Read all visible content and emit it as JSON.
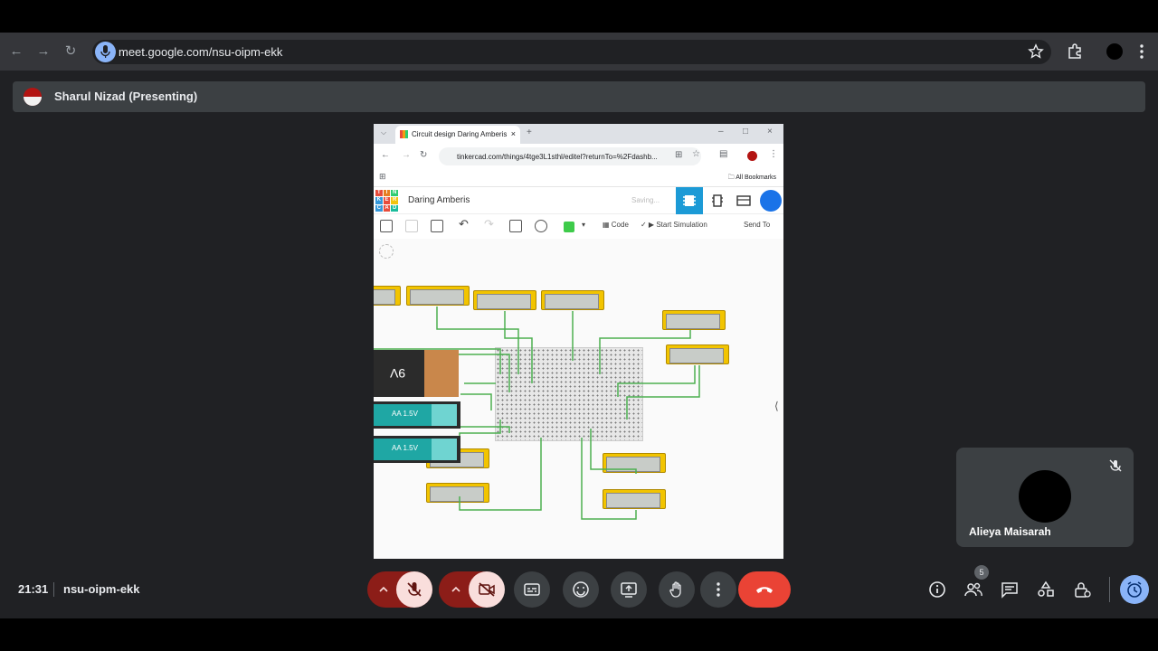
{
  "browser": {
    "url": "meet.google.com/nsu-oipm-ekk"
  },
  "presenter": {
    "name": "Sharul Nizad (Presenting)"
  },
  "shared_screen": {
    "tab_title": "Circuit design Daring Amberis",
    "url": "tinkercad.com/things/4tge3L1sthl/editel?returnTo=%2Fdashb...",
    "bookmarks_label": "All Bookmarks",
    "logo_letters": [
      "T",
      "I",
      "N",
      "K",
      "E",
      "R",
      "C",
      "A",
      "D"
    ],
    "logo_colors": [
      "#e74c3c",
      "#e67e22",
      "#2ecc71",
      "#3498db",
      "#e74c3c",
      "#f1c40f",
      "#3498db",
      "#e74c3c",
      "#1abc9c"
    ],
    "design_title": "Daring Amberis",
    "saving_text": "Saving...",
    "code_label": "Code",
    "start_simulation_label": "Start Simulation",
    "send_to_label": "Send To",
    "battery_9v_label": "9V",
    "aa_label_1": "AA 1.5V",
    "aa_label_2": "AA 1.5V"
  },
  "participant": {
    "name": "Alieya Maisarah"
  },
  "bottom": {
    "time": "21:31",
    "meeting_code": "nsu-oipm-ekk",
    "participants_count": "5"
  },
  "colors": {
    "end_call": "#ea4335",
    "mic_off_bg": "#f9dedc",
    "wire": "#4caf50",
    "accent": "#8ab4f8"
  }
}
